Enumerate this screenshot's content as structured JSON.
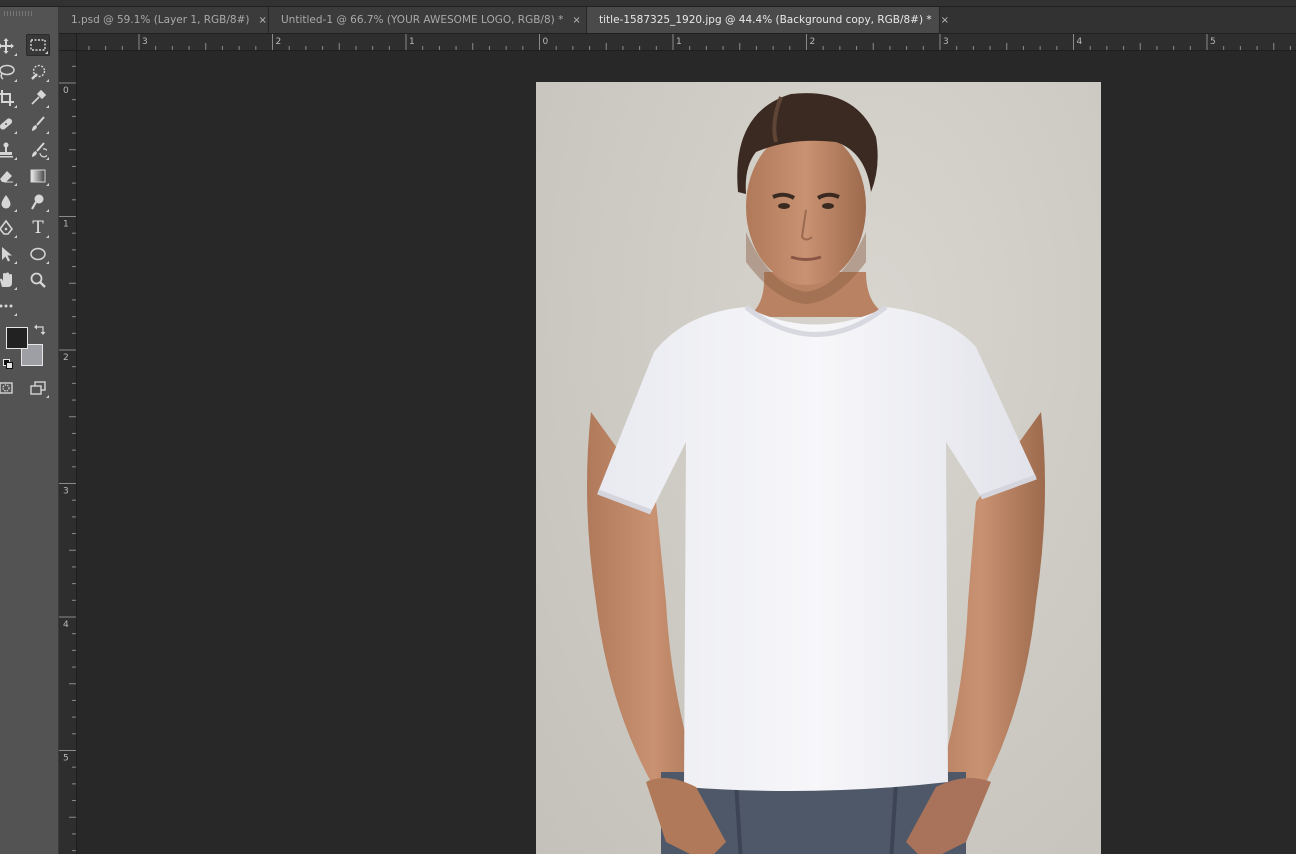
{
  "tabs": [
    {
      "label": "1.psd @ 59.1% (Layer 1, RGB/8#)",
      "close": "×",
      "active": false
    },
    {
      "label": "Untitled-1 @ 66.7% (YOUR AWESOME LOGO, RGB/8) *",
      "close": "×",
      "active": false
    },
    {
      "label": "title-1587325_1920.jpg @ 44.4% (Background copy, RGB/8#) *",
      "close": "×",
      "active": true
    }
  ],
  "ruler": {
    "horizontal_labels": [
      "3",
      "2",
      "1",
      "0",
      "1",
      "2",
      "3",
      "4",
      "5"
    ],
    "vertical_labels": [
      "0",
      "1",
      "2",
      "3",
      "4",
      "5"
    ]
  },
  "tools": [
    "move-tool-icon",
    "rectangular-marquee-tool-icon",
    "lasso-tool-icon",
    "quick-selection-tool-icon",
    "crop-tool-icon",
    "eyedropper-tool-icon",
    "healing-brush-tool-icon",
    "brush-tool-icon",
    "clone-stamp-tool-icon",
    "history-brush-tool-icon",
    "eraser-tool-icon",
    "gradient-tool-icon",
    "blur-tool-icon",
    "dodge-tool-icon",
    "pen-tool-icon",
    "type-tool-icon",
    "path-selection-tool-icon",
    "ellipse-tool-icon",
    "hand-tool-icon",
    "zoom-tool-icon",
    "edit-toolbar-icon",
    "quick-mask-icon",
    "screen-mode-icon"
  ],
  "type_tool_glyph": "T",
  "colors": {
    "foreground": "#222222",
    "background": "#9e9fa4",
    "accent_active_tab": "#4a4a4a"
  }
}
